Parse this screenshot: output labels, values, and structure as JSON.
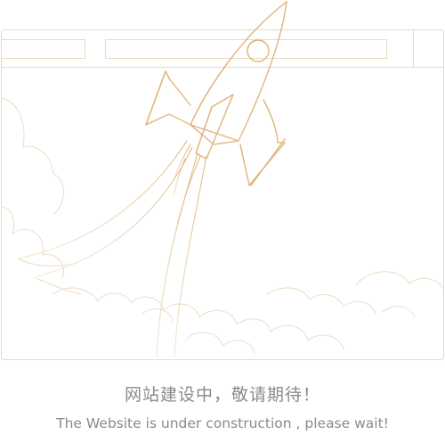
{
  "palette": {
    "frame": "#EAD9C2",
    "rocket": "#D9A76A",
    "rocket_light": "#E9C79A",
    "clouds": "#EDDCC5",
    "text": "#8A8A8A"
  },
  "illustration": {
    "subject": "rocket launching out of a browser window among clouds",
    "icons": [
      "browser-window",
      "rocket-icon",
      "cloud-icon"
    ]
  },
  "message": {
    "cn": "网站建设中，敬请期待！",
    "en": "The Website is under construction , please wait!"
  }
}
